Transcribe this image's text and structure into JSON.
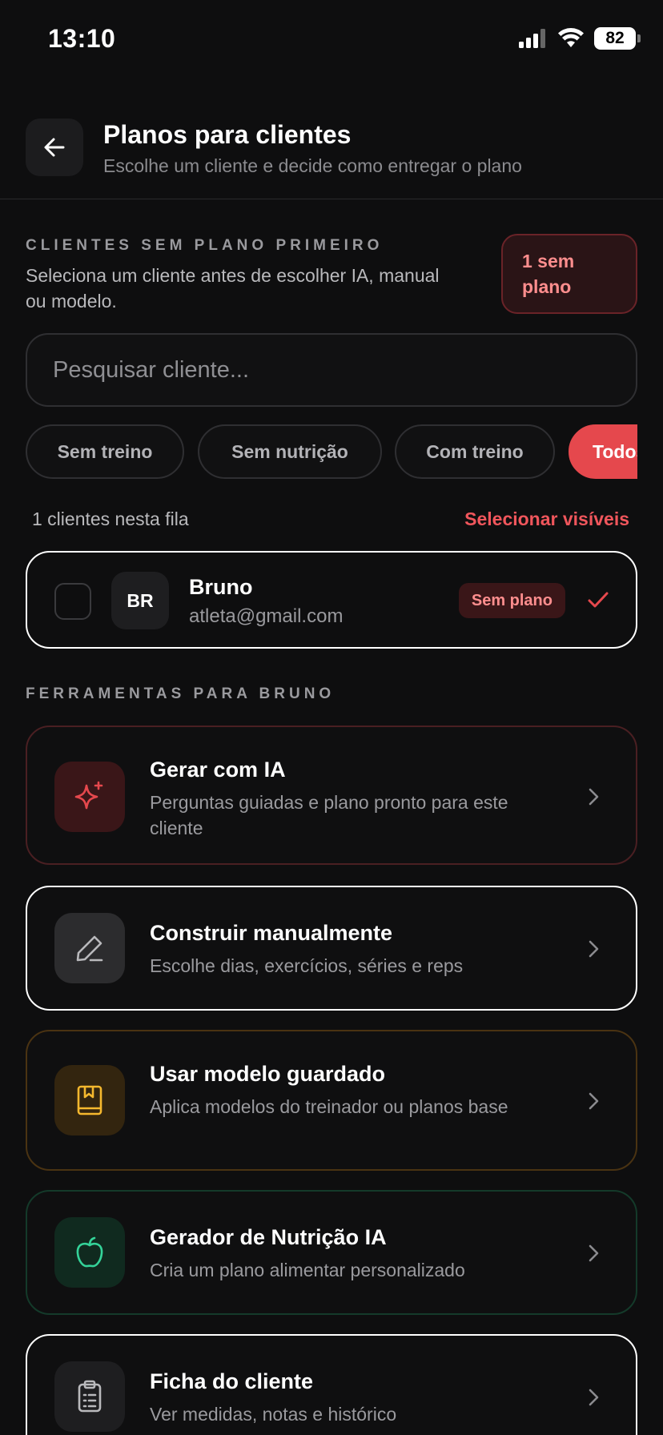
{
  "status": {
    "time": "13:10",
    "battery": "82"
  },
  "header": {
    "title": "Planos para clientes",
    "subtitle": "Escolhe um cliente e decide como entregar o plano"
  },
  "clients_section": {
    "label": "CLIENTES SEM PLANO PRIMEIRO",
    "description": "Seleciona um cliente antes de escolher IA, manual ou modelo.",
    "badge_line1": "1 sem",
    "badge_line2": "plano"
  },
  "search": {
    "placeholder": "Pesquisar cliente..."
  },
  "filters": [
    {
      "label": "Sem treino"
    },
    {
      "label": "Sem nutrição"
    },
    {
      "label": "Com treino"
    },
    {
      "label": "Todos"
    }
  ],
  "queue": {
    "count_text": "1 clientes nesta fila",
    "select_visible": "Selecionar visíveis"
  },
  "client": {
    "initials": "BR",
    "name": "Bruno",
    "email": "atleta@gmail.com",
    "status": "Sem plano"
  },
  "tools_section": {
    "label": "FERRAMENTAS PARA BRUNO"
  },
  "tools": [
    {
      "title": "Gerar com IA",
      "description": "Perguntas guiadas e plano pronto para este cliente",
      "icon": "sparkles-icon",
      "accent": "#e5484d"
    },
    {
      "title": "Construir manualmente",
      "description": "Escolhe dias, exercícios, séries e reps",
      "icon": "pencil-icon",
      "accent": "#b9b9bc"
    },
    {
      "title": "Usar modelo guardado",
      "description": "Aplica modelos do treinador ou planos base",
      "icon": "bookmark-book-icon",
      "accent": "#f5b82e"
    },
    {
      "title": "Gerador de Nutrição IA",
      "description": "Cria um plano alimentar personalizado",
      "icon": "apple-icon",
      "accent": "#34d399"
    },
    {
      "title": "Ficha do cliente",
      "description": "Ver medidas, notas e histórico",
      "icon": "clipboard-icon",
      "accent": "#b9b9bc"
    }
  ]
}
